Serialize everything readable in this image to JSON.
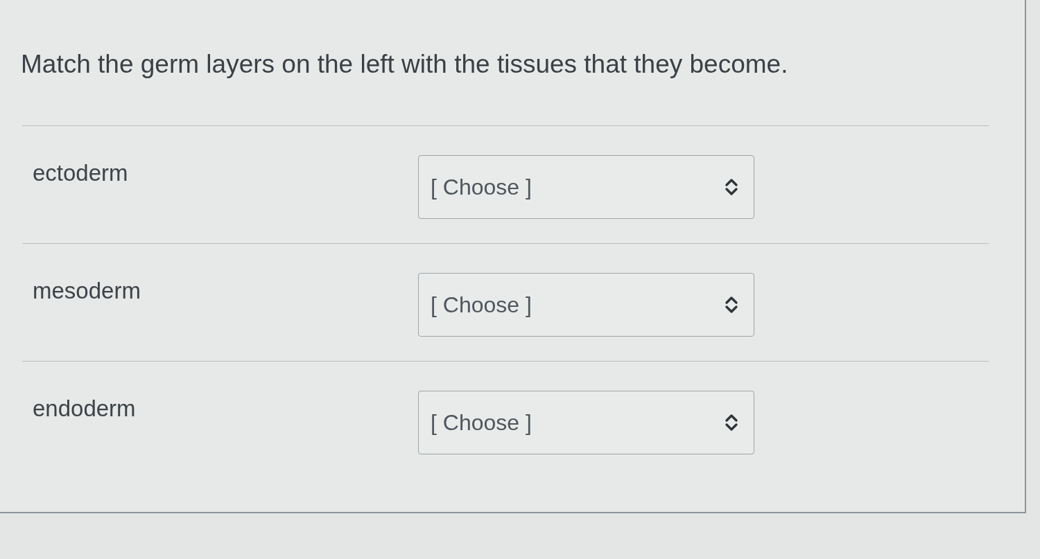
{
  "question": {
    "text": "Match the germ layers on the left with the tissues that they become."
  },
  "rows": [
    {
      "label": "ectoderm",
      "select": {
        "value": "[ Choose ]"
      }
    },
    {
      "label": "mesoderm",
      "select": {
        "value": "[ Choose ]"
      }
    },
    {
      "label": "endoderm",
      "select": {
        "value": "[ Choose ]"
      }
    }
  ]
}
